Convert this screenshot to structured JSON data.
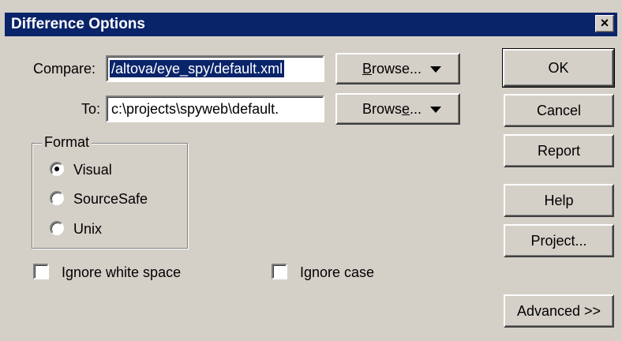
{
  "window": {
    "title": "Difference Options",
    "close_glyph": "×"
  },
  "compare": {
    "label": "Compare:",
    "value": "/altova/eye_spy/default.xml",
    "browse_label_prefix": "",
    "browse_label_underlined": "B",
    "browse_label_suffix": "rowse..."
  },
  "to": {
    "label": "To:",
    "value": "c:\\projects\\spyweb\\default.",
    "browse_label_prefix": "Brows",
    "browse_label_underlined": "e",
    "browse_label_suffix": "..."
  },
  "format": {
    "title": "Format",
    "options": [
      {
        "label": "Visual",
        "selected": true
      },
      {
        "label": "SourceSafe",
        "selected": false
      },
      {
        "label": "Unix",
        "selected": false
      }
    ]
  },
  "options": {
    "ignore_whitespace": {
      "label": "Ignore white space",
      "checked": false
    },
    "ignore_case": {
      "label": "Ignore case",
      "checked": false
    }
  },
  "buttons": {
    "ok": "OK",
    "cancel": "Cancel",
    "report": "Report",
    "help": "Help",
    "project": "Project...",
    "advanced": "Advanced >>"
  },
  "colors": {
    "dialog_bg": "#d4d0c8",
    "titlebar": "#0a246a",
    "selection": "#0a246a"
  }
}
